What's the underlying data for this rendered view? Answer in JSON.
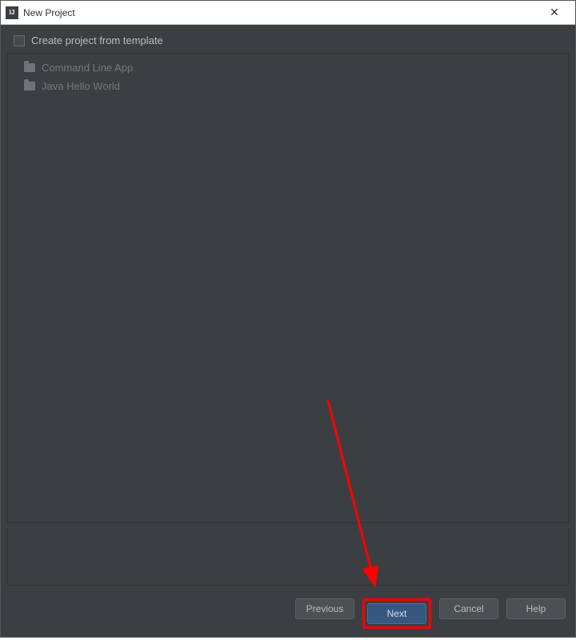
{
  "titlebar": {
    "icon_text": "IJ",
    "title": "New Project",
    "close_symbol": "✕"
  },
  "checkbox": {
    "label": "Create project from template"
  },
  "templates": [
    {
      "label": "Command Line App"
    },
    {
      "label": "Java Hello World"
    }
  ],
  "buttons": {
    "previous": "Previous",
    "next": "Next",
    "cancel": "Cancel",
    "help": "Help"
  }
}
